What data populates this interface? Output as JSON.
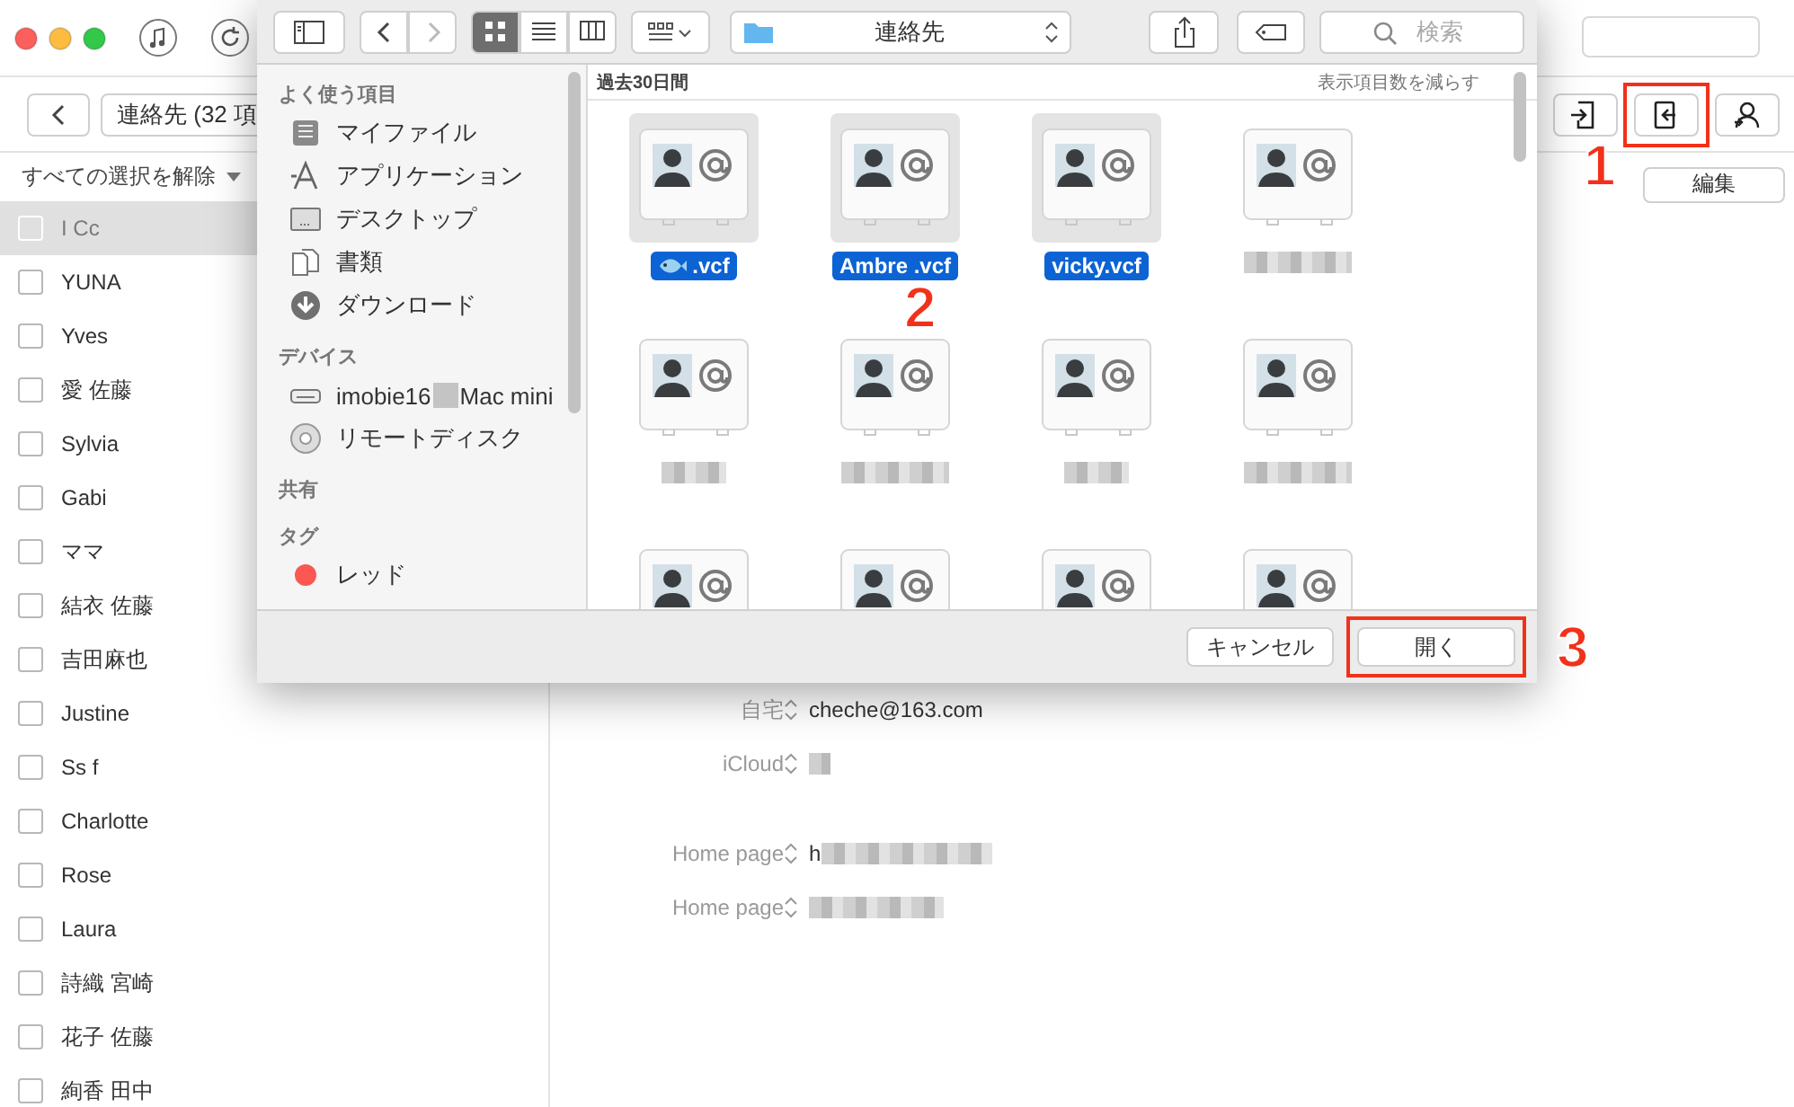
{
  "app": {
    "breadcrumb": "連絡先 (32 項",
    "actions": [
      {
        "kind": "import",
        "highlighted": false
      },
      {
        "kind": "export",
        "highlighted": true
      },
      {
        "kind": "contact",
        "highlighted": false
      }
    ],
    "deselect_menu": "すべての選択を解除",
    "edit_button": "編集",
    "contacts": [
      {
        "name": "I Cc",
        "checked": false,
        "selected": true
      },
      {
        "name": "YUNA",
        "checked": false,
        "selected": false
      },
      {
        "name": "Yves",
        "checked": false,
        "selected": false
      },
      {
        "name": "愛 佐藤",
        "checked": false,
        "selected": false
      },
      {
        "name": "Sylvia",
        "checked": false,
        "selected": false
      },
      {
        "name": "Gabi",
        "checked": false,
        "selected": false
      },
      {
        "name": "ママ",
        "checked": false,
        "selected": false
      },
      {
        "name": "結衣 佐藤",
        "checked": false,
        "selected": false
      },
      {
        "name": "吉田麻也",
        "checked": false,
        "selected": false
      },
      {
        "name": "Justine",
        "checked": false,
        "selected": false
      },
      {
        "name": "Ss f",
        "checked": false,
        "selected": false
      },
      {
        "name": "Charlotte",
        "checked": false,
        "selected": false
      },
      {
        "name": "Rose",
        "checked": false,
        "selected": false
      },
      {
        "name": "Laura",
        "checked": false,
        "selected": false
      },
      {
        "name": "詩織 宮崎",
        "checked": false,
        "selected": false
      },
      {
        "name": "花子 佐藤",
        "checked": false,
        "selected": false
      },
      {
        "name": "絢香 田中",
        "checked": false,
        "selected": false
      }
    ],
    "detail_groups": [
      [
        {
          "label": "自宅",
          "value": "cheche@163.com",
          "redacted": false
        },
        {
          "label": "iCloud",
          "redacted": true
        }
      ],
      [
        {
          "label": "Home page",
          "value": "h",
          "redacted": true
        },
        {
          "label": "Home page",
          "redacted": true
        }
      ]
    ]
  },
  "dialog": {
    "view_modes": [
      {
        "kind": "icon",
        "selected": true
      },
      {
        "kind": "list",
        "selected": false
      },
      {
        "kind": "column",
        "selected": false
      }
    ],
    "path": "連絡先",
    "search": {
      "placeholder": "検索"
    },
    "sidebar": [
      {
        "heading": "よく使う項目",
        "items": [
          {
            "label": "マイファイル",
            "kind": "files"
          },
          {
            "label": "アプリケーション",
            "kind": "apps"
          },
          {
            "label": "デスクトップ",
            "kind": "desktop"
          },
          {
            "label": "書類",
            "kind": "documents"
          },
          {
            "label": "ダウンロード",
            "kind": "download"
          }
        ]
      },
      {
        "heading": "デバイス",
        "items": [
          {
            "label": "imobie16",
            "label_after": "Mac mini",
            "kind": "computer",
            "redacted": true
          },
          {
            "label": "リモートディスク",
            "kind": "disc"
          }
        ]
      },
      {
        "heading": "共有"
      },
      {
        "heading": "タグ",
        "items": [
          {
            "label": "レッド",
            "kind": "tag",
            "color": "#fc5753"
          }
        ]
      }
    ],
    "group_title": "過去30日間",
    "show_less": "表示項目数を減らす",
    "files": [
      {
        "kind": "badged",
        "name": ".vcf",
        "selected": true
      },
      {
        "kind": "named",
        "name": "Ambre .vcf",
        "selected": true
      },
      {
        "kind": "named",
        "name": "vicky.vcf",
        "selected": true
      },
      {
        "kind": "redacted",
        "selected": false
      },
      {
        "kind": "redacted",
        "selected": false
      },
      {
        "kind": "redacted",
        "selected": false
      },
      {
        "kind": "redacted",
        "selected": false
      },
      {
        "kind": "redacted",
        "selected": false
      },
      {
        "kind": "unlabeled",
        "selected": false
      },
      {
        "kind": "unlabeled",
        "selected": false
      },
      {
        "kind": "unlabeled",
        "selected": false
      },
      {
        "kind": "unlabeled",
        "selected": false
      }
    ],
    "buttons": [
      {
        "label": "キャンセル",
        "highlighted": false
      },
      {
        "label": "開く",
        "highlighted": true
      }
    ]
  },
  "annotations": [
    {
      "label": "1"
    },
    {
      "label": "2"
    },
    {
      "label": "3"
    }
  ]
}
